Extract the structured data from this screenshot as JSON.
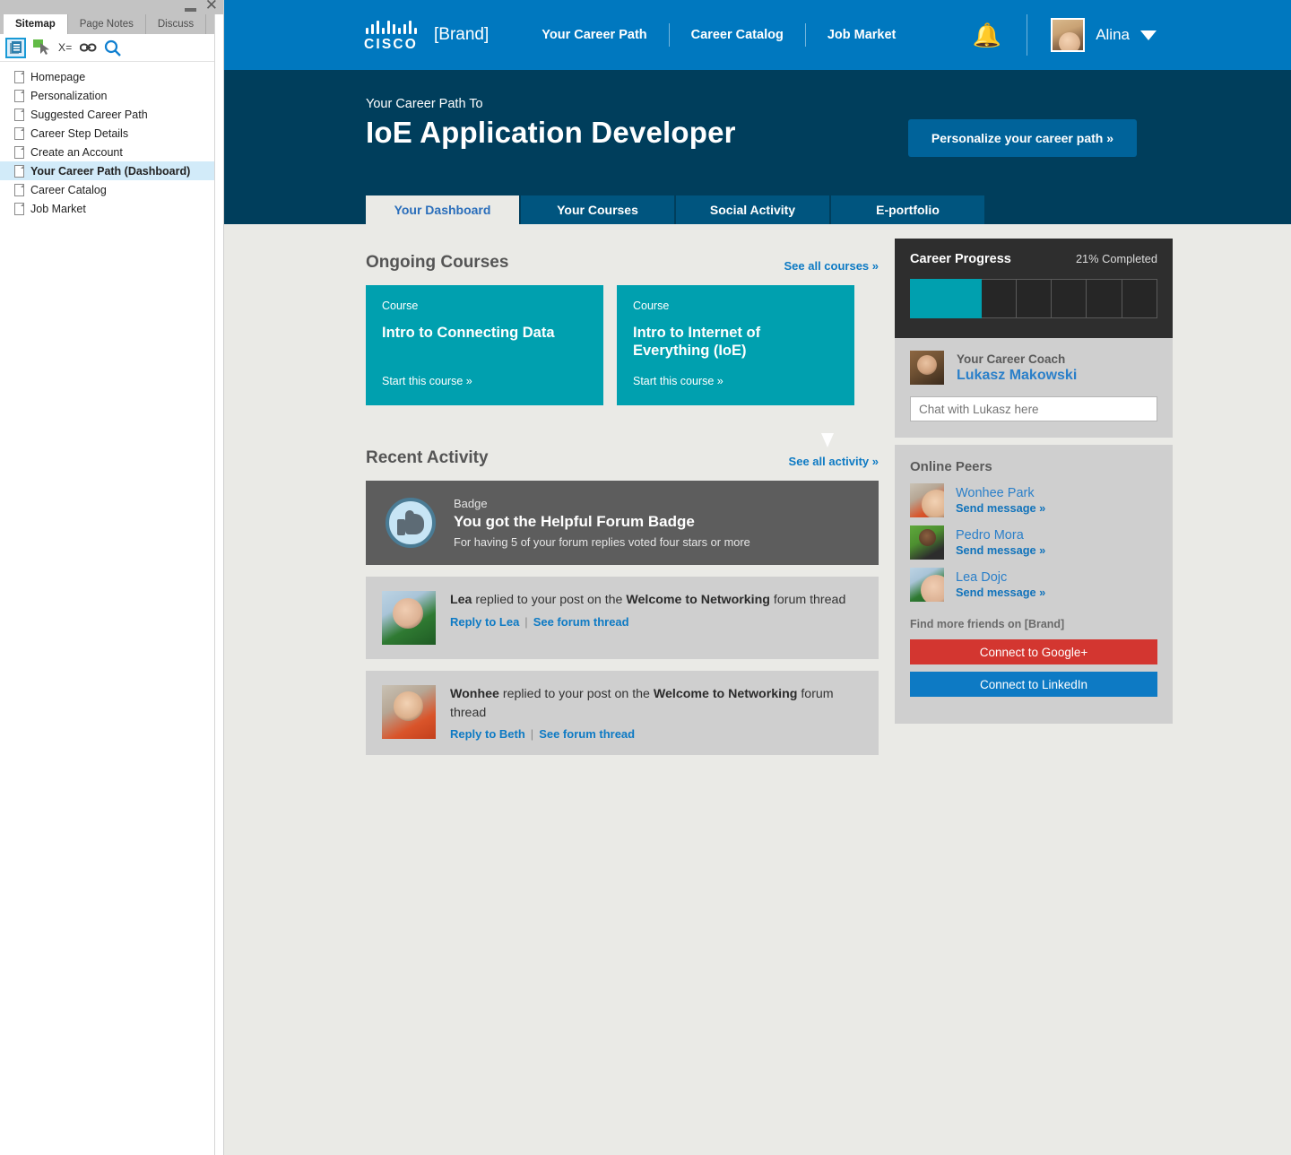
{
  "sitemap": {
    "window": {
      "minimize": "—",
      "close": "✕"
    },
    "tabs": [
      {
        "label": "Sitemap",
        "active": true
      },
      {
        "label": "Page Notes",
        "active": false
      },
      {
        "label": "Discuss",
        "active": false
      }
    ],
    "toolbar": [
      {
        "name": "sitemap-icon",
        "label": ""
      },
      {
        "name": "cursor-icon",
        "label": ""
      },
      {
        "name": "variable-icon",
        "label": "X="
      },
      {
        "name": "link-icon",
        "label": ""
      },
      {
        "name": "search-icon",
        "label": ""
      }
    ],
    "items": [
      {
        "label": "Homepage",
        "selected": false
      },
      {
        "label": "Personalization",
        "selected": false
      },
      {
        "label": "Suggested Career Path",
        "selected": false
      },
      {
        "label": "Career Step Details",
        "selected": false
      },
      {
        "label": "Create an Account",
        "selected": false
      },
      {
        "label": "Your Career Path (Dashboard)",
        "selected": true
      },
      {
        "label": "Career Catalog",
        "selected": false
      },
      {
        "label": "Job Market",
        "selected": false
      }
    ]
  },
  "globalnav": {
    "logo_word": "CISCO",
    "brand": "[Brand]",
    "links": [
      {
        "label": "Your Career Path"
      },
      {
        "label": "Career Catalog"
      },
      {
        "label": "Job Market"
      }
    ],
    "notifications_icon": "bell-icon",
    "user": {
      "name": "Alina",
      "caret": "▼"
    }
  },
  "hero": {
    "kicker": "Your Career Path To",
    "title": "IoE Application Developer",
    "cta": "Personalize your career path »"
  },
  "tabs": [
    {
      "label": "Your Dashboard",
      "active": true
    },
    {
      "label": "Your Courses",
      "active": false
    },
    {
      "label": "Social Activity",
      "active": false
    },
    {
      "label": "E-portfolio",
      "active": false
    }
  ],
  "ongoing_courses": {
    "title": "Ongoing Courses",
    "see_all": "See all courses »",
    "cards": [
      {
        "kicker": "Course",
        "name": "Intro to Connecting Data",
        "cta": "Start this course »"
      },
      {
        "kicker": "Course",
        "name": "Intro to Internet of Everything (IoE)",
        "cta": "Start this course »"
      }
    ]
  },
  "recent_activity": {
    "title": "Recent Activity",
    "see_all": "See all activity »",
    "badge": {
      "kicker": "Badge",
      "title": "You got the Helpful Forum Badge",
      "subtitle": "For having 5 of your forum replies voted four stars or more"
    },
    "items": [
      {
        "author": "Lea",
        "text_mid": " replied to your post on the ",
        "thread": "Welcome to Networking",
        "text_end": " forum thread",
        "reply_link": "Reply to Lea",
        "thread_link": "See forum thread"
      },
      {
        "author": "Wonhee",
        "text_mid": " replied to your post on the ",
        "thread": "Welcome to Networking",
        "text_end": " forum thread",
        "reply_link": "Reply to Beth",
        "thread_link": "See forum thread"
      }
    ]
  },
  "career_progress": {
    "title": "Career Progress",
    "percent_label": "21% Completed",
    "segments_total": 7,
    "segments_filled": 2
  },
  "coach": {
    "label": "Your Career Coach",
    "name": "Lukasz Makowski",
    "chat_placeholder": "Chat with Lukasz here"
  },
  "online_peers": {
    "title": "Online Peers",
    "people": [
      {
        "name": "Wonhee Park",
        "action": "Send message »"
      },
      {
        "name": "Pedro Mora",
        "action": "Send message »"
      },
      {
        "name": "Lea Dojc",
        "action": "Send message »"
      }
    ],
    "find_more": "Find more friends on [Brand]",
    "buttons": [
      {
        "label": "Connect to Google+",
        "color": "#d33630"
      },
      {
        "label": "Connect to LinkedIn",
        "color": "#0d7ac4"
      }
    ]
  },
  "colors": {
    "nav_blue": "#0078bf",
    "hero_navy": "#003e5c",
    "tab_blue": "#00557f",
    "teal": "#00a0af",
    "link_blue": "#0d7ac4",
    "page_bg": "#eaeae6"
  }
}
